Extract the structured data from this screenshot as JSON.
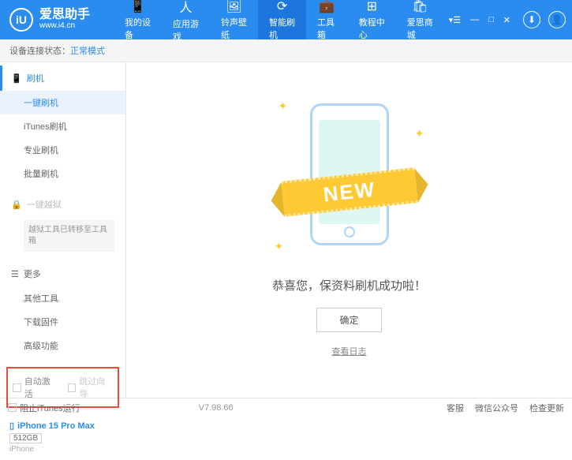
{
  "app": {
    "name": "爱思助手",
    "url": "www.i4.cn",
    "logo_letter": "iU"
  },
  "top_nav": {
    "items": [
      {
        "label": "我的设备"
      },
      {
        "label": "应用游戏"
      },
      {
        "label": "铃声壁纸"
      },
      {
        "label": "智能刷机"
      },
      {
        "label": "工具箱"
      },
      {
        "label": "教程中心"
      },
      {
        "label": "爱思商城"
      }
    ]
  },
  "status": {
    "label": "设备连接状态：",
    "value": "正常模式"
  },
  "sidebar": {
    "flash": {
      "header": "刷机",
      "items": [
        {
          "label": "一键刷机"
        },
        {
          "label": "iTunes刷机"
        },
        {
          "label": "专业刷机"
        },
        {
          "label": "批量刷机"
        }
      ]
    },
    "jailbreak": {
      "header": "一键越狱",
      "note": "越狱工具已转移至工具箱"
    },
    "more": {
      "header": "更多",
      "items": [
        {
          "label": "其他工具"
        },
        {
          "label": "下载固件"
        },
        {
          "label": "高级功能"
        }
      ]
    },
    "checkboxes": {
      "auto_activate": "自动激活",
      "skip_guide": "跳过向导"
    }
  },
  "device": {
    "name": "iPhone 15 Pro Max",
    "storage": "512GB",
    "type": "iPhone"
  },
  "content": {
    "banner": "NEW",
    "message": "恭喜您，保资料刷机成功啦！",
    "confirm": "确定",
    "log_link": "查看日志"
  },
  "footer": {
    "block_itunes": "阻止iTunes运行",
    "version": "V7.98.66",
    "links": [
      "客服",
      "微信公众号",
      "检查更新"
    ]
  }
}
